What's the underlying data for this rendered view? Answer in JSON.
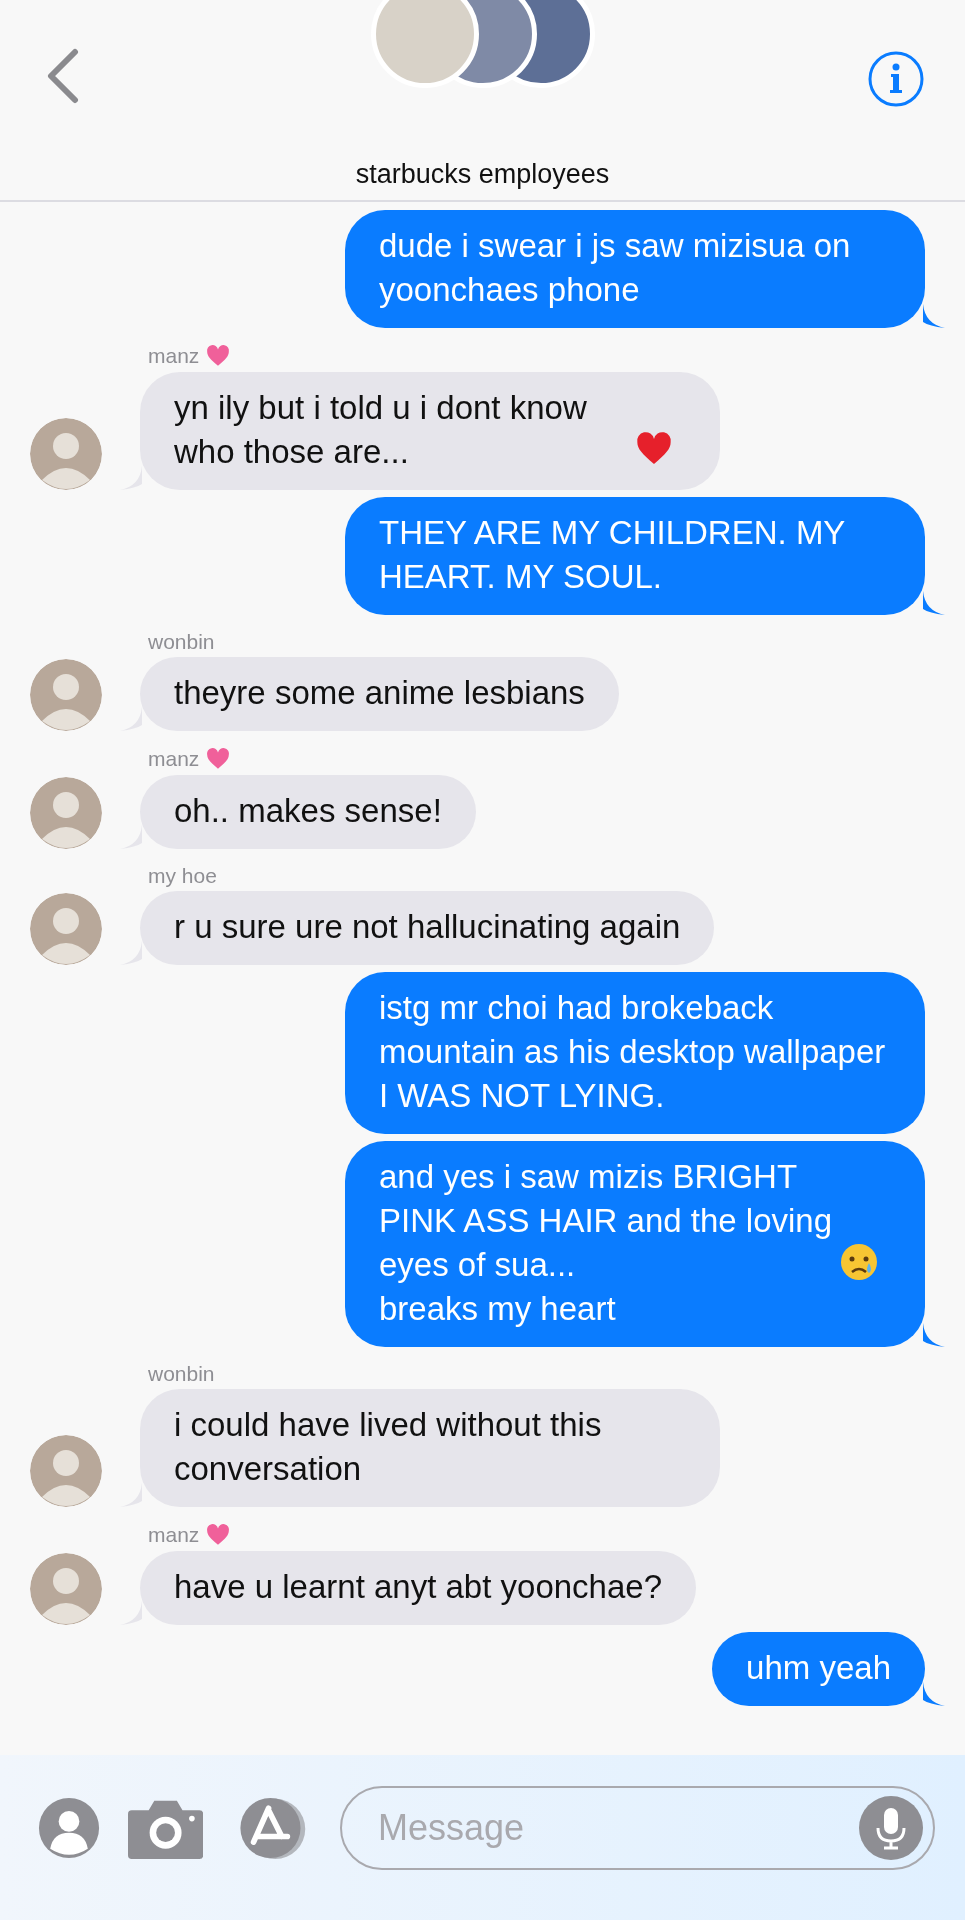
{
  "header": {
    "title": "starbucks employees"
  },
  "messages": [
    {
      "kind": "sent",
      "parts": [
        {
          "kind": "text",
          "text": "dude i swear i js saw mizisua on yoonchaes phone"
        }
      ]
    },
    {
      "kind": "received",
      "sender": "manz",
      "heart": true,
      "parts": [
        {
          "kind": "text",
          "text": "yn ily but i told u i dont know who those are..."
        },
        {
          "kind": "heart_emoji"
        }
      ]
    },
    {
      "kind": "sent",
      "parts": [
        {
          "kind": "text",
          "text": "THEY ARE MY CHILDREN. MY HEART. MY SOUL."
        }
      ]
    },
    {
      "kind": "received",
      "sender": "wonbin",
      "heart": false,
      "parts": [
        {
          "kind": "text",
          "text": "theyre some anime lesbians"
        }
      ]
    },
    {
      "kind": "received",
      "sender": "manz",
      "heart": true,
      "parts": [
        {
          "kind": "text",
          "text": "oh.. makes sense!"
        }
      ]
    },
    {
      "kind": "received",
      "sender": "my hoe",
      "heart": false,
      "parts": [
        {
          "kind": "text",
          "text": "r u sure ure not hallucinating again"
        }
      ]
    },
    {
      "kind": "sent",
      "parts": [
        {
          "kind": "text",
          "text": "istg mr choi had brokeback mountain as his desktop wallpaper I WAS NOT LYING."
        }
      ]
    },
    {
      "kind": "sent",
      "parts": [
        {
          "kind": "text",
          "text": "and yes i saw mizis BRIGHT PINK ASS HAIR and the loving eyes of sua..."
        },
        {
          "kind": "crying_emoji"
        },
        {
          "kind": "text",
          "text": "breaks my heart"
        }
      ]
    },
    {
      "kind": "received",
      "sender": "wonbin",
      "heart": false,
      "parts": [
        {
          "kind": "text",
          "text": "i could have lived without this conversation"
        }
      ]
    },
    {
      "kind": "received",
      "sender": "manz",
      "heart": true,
      "parts": [
        {
          "kind": "text",
          "text": "have u learnt anyt abt yoonchae?"
        }
      ]
    },
    {
      "kind": "sent",
      "parts": [
        {
          "kind": "text",
          "text": "uhm yeah"
        }
      ]
    }
  ],
  "composer": {
    "placeholder": "Message"
  }
}
